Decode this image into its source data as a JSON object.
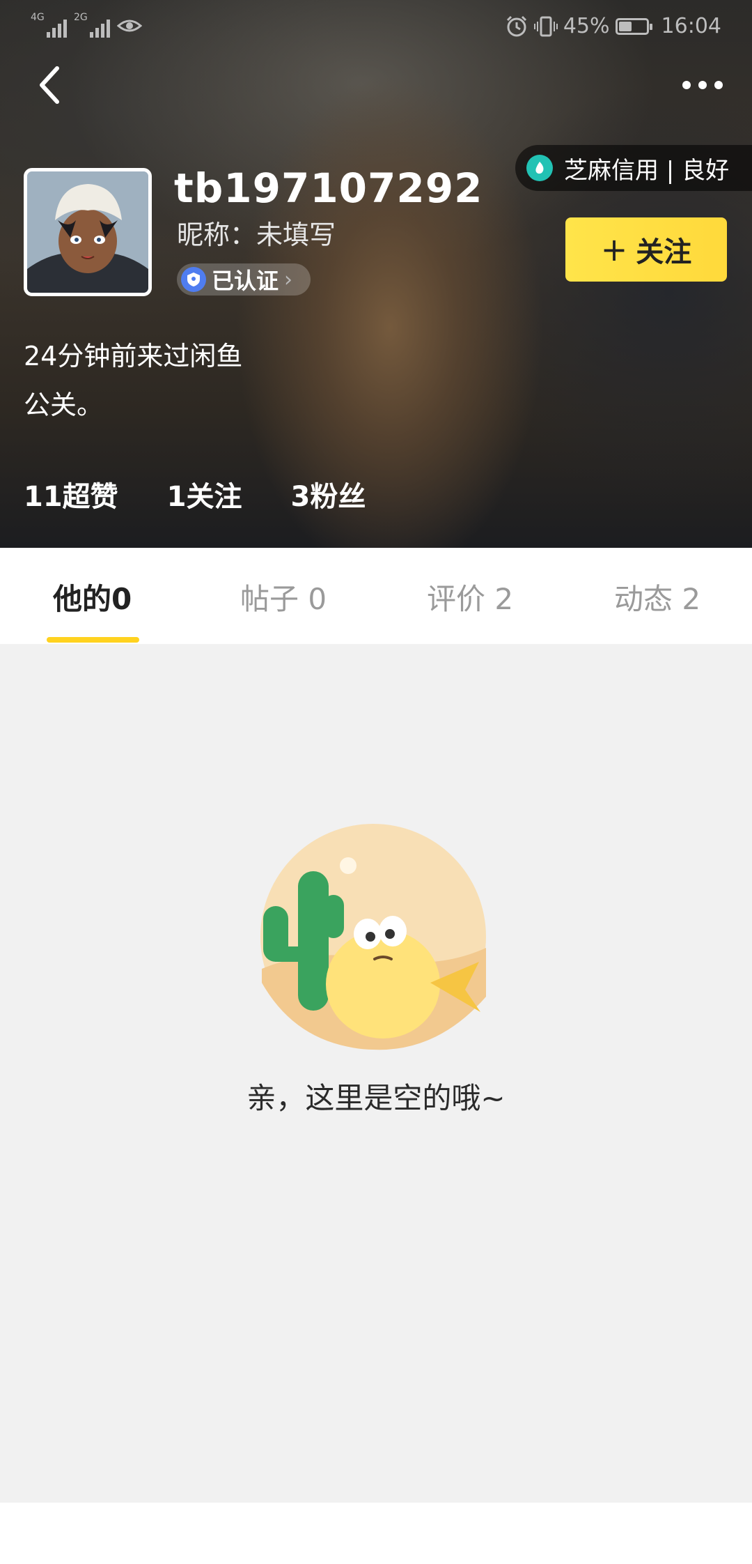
{
  "status_bar": {
    "signal1_tag": "4G",
    "signal2_tag": "2G",
    "battery_percent": "45%",
    "battery_level": 0.45,
    "time": "16:04"
  },
  "profile": {
    "username": "tb197107292",
    "nickname": "昵称：未填写",
    "verified_label": "已认证",
    "credit_label": "芝麻信用 | 良好",
    "follow_label": "关注",
    "bio_lines": [
      "24分钟前来过闲鱼",
      "公关。"
    ],
    "stats": [
      {
        "label": "11超赞"
      },
      {
        "label": "1关注"
      },
      {
        "label": "3粉丝"
      }
    ]
  },
  "tabs": [
    {
      "label": "他的0",
      "active": true
    },
    {
      "label": "帖子 0",
      "active": false
    },
    {
      "label": "评价 2",
      "active": false
    },
    {
      "label": "动态 2",
      "active": false
    }
  ],
  "empty_state": {
    "message": "亲，这里是空的哦~"
  },
  "colors": {
    "accent_yellow": "#ffd93b",
    "tab_underline": "#ffd21f",
    "credit_icon": "#22c2b4",
    "verified_icon": "#4f7df0",
    "content_bg": "#f1f1f1"
  },
  "icons": {
    "back": "chevron-left-icon",
    "more": "more-dots-icon",
    "alarm": "alarm-icon",
    "vibrate": "vibrate-icon",
    "eye": "eye-icon"
  }
}
